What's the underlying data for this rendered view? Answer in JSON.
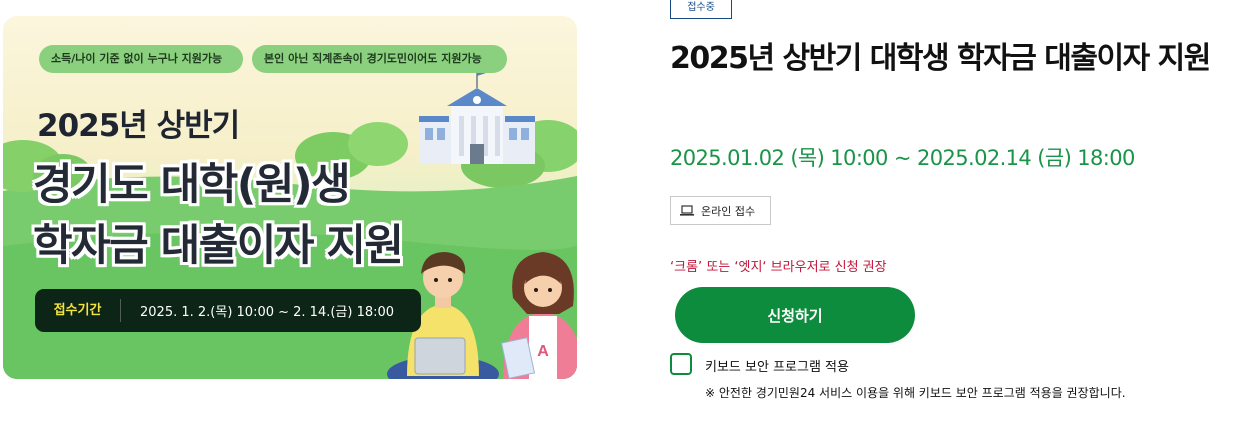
{
  "banner": {
    "pills": [
      "소득/나이 기준 없이 누구나 지원가능",
      "본인 아닌 직계존속이 경기도민이어도 지원가능"
    ],
    "year_line": "2025년 상반기",
    "title_line1": "경기도 대학(원)생",
    "title_line2": "학자금 대출이자 지원",
    "period_label": "접수기간",
    "period_value": "2025. 1. 2.(목) 10:00 ~ 2. 14.(금) 18:00",
    "letter_mark": "A"
  },
  "detail": {
    "status": "접수중",
    "title": "2025년 상반기 대학생 학자금 대출이자 지원",
    "date_range": "2025.01.02 (목) 10:00 ~ 2025.02.14 (금) 18:00",
    "online_label": "온라인 접수",
    "online_icon": "laptop-icon",
    "browser_notice": "‘크롬’ 또는 ‘엣지‘ 브라우저로 신청 권장",
    "apply_label": "신청하기",
    "keyboard_security_label": "키보드 보안 프로그램 적용",
    "keyboard_security_checked": false,
    "keyboard_security_note": "※ 안전한 경기민원24 서비스 이용을 위해 키보드 보안 프로그램 적용을 권장합니다."
  },
  "colors": {
    "accent_green": "#0e8c3e",
    "date_green": "#1a9448",
    "notice_red": "#c0163a",
    "status_blue": "#174b86",
    "banner_dark": "#0d2516",
    "banner_yellow": "#f3e441"
  }
}
